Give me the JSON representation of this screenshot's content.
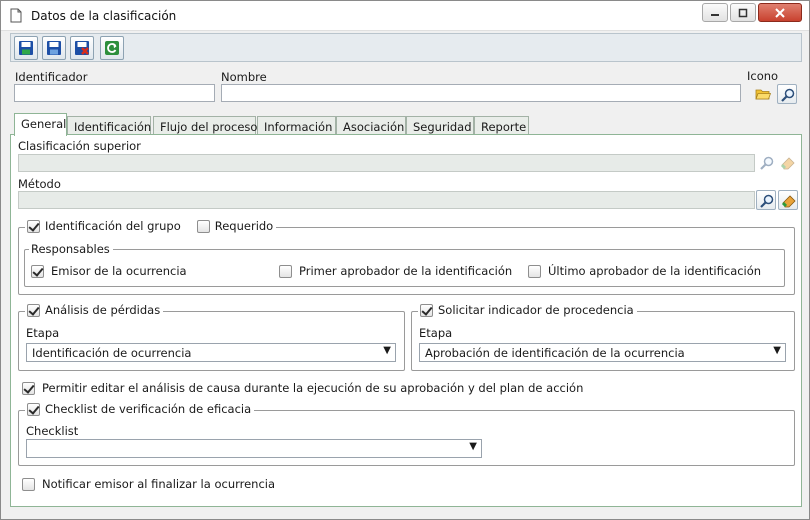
{
  "window": {
    "title": "Datos de la clasificación"
  },
  "toolbar": {
    "save": "save-icon",
    "save_new": "save-new-icon",
    "save_close": "save-close-icon",
    "refresh": "refresh-icon"
  },
  "fields": {
    "identificador_label": "Identificador",
    "identificador_value": "",
    "nombre_label": "Nombre",
    "nombre_value": "",
    "icono_label": "Icono"
  },
  "tabs": [
    "General",
    "Identificación",
    "Flujo del proceso",
    "Información",
    "Asociación",
    "Seguridad",
    "Reporte"
  ],
  "general": {
    "clasificacion_superior_label": "Clasificación superior",
    "clasificacion_superior_value": "",
    "metodo_label": "Método",
    "metodo_value": "",
    "identificacion_grupo": {
      "label": "Identificación del grupo",
      "checked": true
    },
    "requerido": {
      "label": "Requerido",
      "checked": false
    },
    "responsables": {
      "title": "Responsables",
      "emisor": {
        "label": "Emisor de la ocurrencia",
        "checked": true
      },
      "primer_aprobador": {
        "label": "Primer aprobador de la identificación",
        "checked": false
      },
      "ultimo_aprobador": {
        "label": "Último aprobador de la identificación",
        "checked": false
      }
    },
    "analisis_perdidas": {
      "label": "Análisis de pérdidas",
      "checked": true,
      "etapa_label": "Etapa",
      "etapa_value": "Identificación de ocurrencia"
    },
    "indicador_procedencia": {
      "label": "Solicitar indicador de procedencia",
      "checked": true,
      "etapa_label": "Etapa",
      "etapa_value": "Aprobación de identificación de la ocurrencia"
    },
    "permitir_editar": {
      "label": "Permitir editar el análisis de causa durante la ejecución de su aprobación y del plan de acción",
      "checked": true
    },
    "checklist_eficacia": {
      "label": "Checklist de verificación de eficacia",
      "checked": true,
      "checklist_label": "Checklist",
      "checklist_value": ""
    },
    "notificar_emisor": {
      "label": "Notificar emisor al finalizar la ocurrencia",
      "checked": false
    }
  },
  "colors": {
    "tab_border": "#8fb596",
    "disabled_field": "#e7ebe8",
    "save_blue": "#1d4fa6",
    "close_red": "#c8412e"
  }
}
